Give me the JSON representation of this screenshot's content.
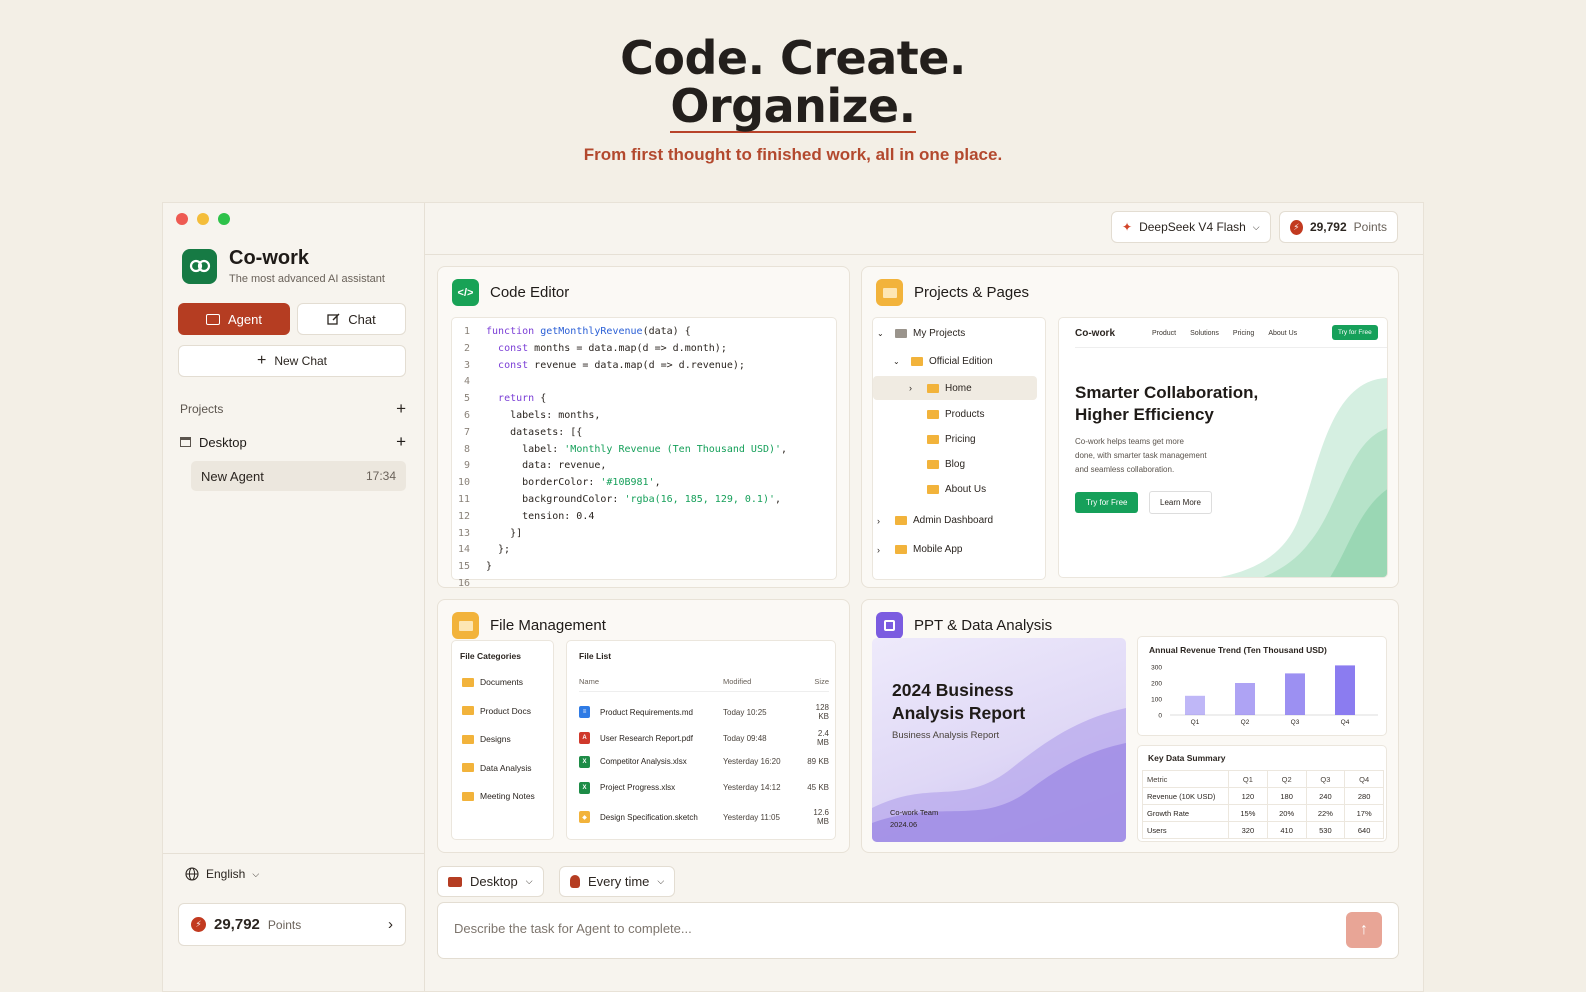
{
  "hero": {
    "title_line1": "Code. Create.",
    "title_line2": "Organize.",
    "subtitle": "From first thought to finished work, all in one place."
  },
  "sidebar": {
    "app_name": "Co-work",
    "app_tagline": "The most advanced AI assistant",
    "agent_label": "Agent",
    "chat_label": "Chat",
    "new_chat_label": "New Chat",
    "projects_label": "Projects",
    "desktop_label": "Desktop",
    "agent_item": {
      "name": "New Agent",
      "time": "17:34"
    },
    "language": "English",
    "points_value": "29,792",
    "points_unit": "Points"
  },
  "topbar": {
    "model": "DeepSeek V4 Flash",
    "points_value": "29,792",
    "points_unit": "Points"
  },
  "code_editor": {
    "title": "Code Editor",
    "lines": [
      {
        "n": "1",
        "text": "function getMonthlyRevenue(data) {"
      },
      {
        "n": "2",
        "text": "  const months = data.map(d => d.month);"
      },
      {
        "n": "3",
        "text": "  const revenue = data.map(d => d.revenue);"
      },
      {
        "n": "4",
        "text": ""
      },
      {
        "n": "5",
        "text": "  return {"
      },
      {
        "n": "6",
        "text": "    labels: months,"
      },
      {
        "n": "7",
        "text": "    datasets: [{"
      },
      {
        "n": "8",
        "text": "      label: 'Monthly Revenue (Ten Thousand USD)',"
      },
      {
        "n": "9",
        "text": "      data: revenue,"
      },
      {
        "n": "10",
        "text": "      borderColor: '#10B981',"
      },
      {
        "n": "11",
        "text": "      backgroundColor: 'rgba(16, 185, 129, 0.1)',"
      },
      {
        "n": "12",
        "text": "      tension: 0.4"
      },
      {
        "n": "13",
        "text": "    }]"
      },
      {
        "n": "14",
        "text": "  };"
      },
      {
        "n": "15",
        "text": "}"
      },
      {
        "n": "16",
        "text": ""
      }
    ]
  },
  "projects": {
    "title": "Projects & Pages",
    "tree": [
      "My Projects",
      "Official Edition",
      "Home",
      "Products",
      "Pricing",
      "Blog",
      "About Us",
      "Admin Dashboard",
      "Mobile App"
    ],
    "preview": {
      "brand": "Co-work",
      "nav": [
        "Product",
        "Solutions",
        "Pricing",
        "About Us"
      ],
      "nav_cta": "Try for Free",
      "headline1": "Smarter Collaboration,",
      "headline2": "Higher Efficiency",
      "body1": "Co-work helps teams get more",
      "body2": "done, with smarter task management",
      "body3": "and seamless collaboration.",
      "cta_primary": "Try for Free",
      "cta_secondary": "Learn More"
    }
  },
  "files": {
    "title": "File Management",
    "categories_title": "File Categories",
    "categories": [
      "Documents",
      "Product Docs",
      "Designs",
      "Data Analysis",
      "Meeting Notes"
    ],
    "list_title": "File List",
    "columns": [
      "Name",
      "Modified",
      "Size"
    ],
    "rows": [
      {
        "name": "Product Requirements.md",
        "modified": "Today 10:25",
        "size": "128 KB",
        "type": "doc"
      },
      {
        "name": "User Research Report.pdf",
        "modified": "Today 09:48",
        "size": "2.4 MB",
        "type": "pdf"
      },
      {
        "name": "Competitor Analysis.xlsx",
        "modified": "Yesterday 16:20",
        "size": "89 KB",
        "type": "xls"
      },
      {
        "name": "Project Progress.xlsx",
        "modified": "Yesterday 14:12",
        "size": "45 KB",
        "type": "xls"
      },
      {
        "name": "Design Specification.sketch",
        "modified": "Yesterday 11:05",
        "size": "12.6 MB",
        "type": "sketch"
      }
    ]
  },
  "ppt": {
    "title": "PPT & Data Analysis",
    "slide_title1": "2024 Business",
    "slide_title2": "Analysis Report",
    "slide_subtitle": "Business Analysis Report",
    "slide_team": "Co-work Team",
    "slide_date": "2024.06",
    "table_title": "Key Data Summary",
    "table_header": [
      "Metric",
      "Q1",
      "Q2",
      "Q3",
      "Q4"
    ],
    "table_rows": [
      [
        "Revenue (10K USD)",
        "120",
        "180",
        "240",
        "280"
      ],
      [
        "Growth Rate",
        "15%",
        "20%",
        "22%",
        "17%"
      ],
      [
        "Users",
        "320",
        "410",
        "530",
        "640"
      ]
    ]
  },
  "chart_data": {
    "type": "bar",
    "title": "Annual Revenue Trend (Ten Thousand USD)",
    "categories": [
      "Q1",
      "Q2",
      "Q3",
      "Q4"
    ],
    "values": [
      120,
      200,
      260,
      310
    ],
    "ylim": [
      0,
      300
    ],
    "yticks": [
      "300",
      "200",
      "100",
      "0"
    ],
    "color": "#8b7cf0"
  },
  "bottom": {
    "location": "Desktop",
    "mode": "Every time",
    "placeholder": "Describe the task for Agent to complete..."
  },
  "colors": {
    "accent": "#b53d22",
    "green": "#16a05a",
    "purple": "#7b5ce0"
  }
}
